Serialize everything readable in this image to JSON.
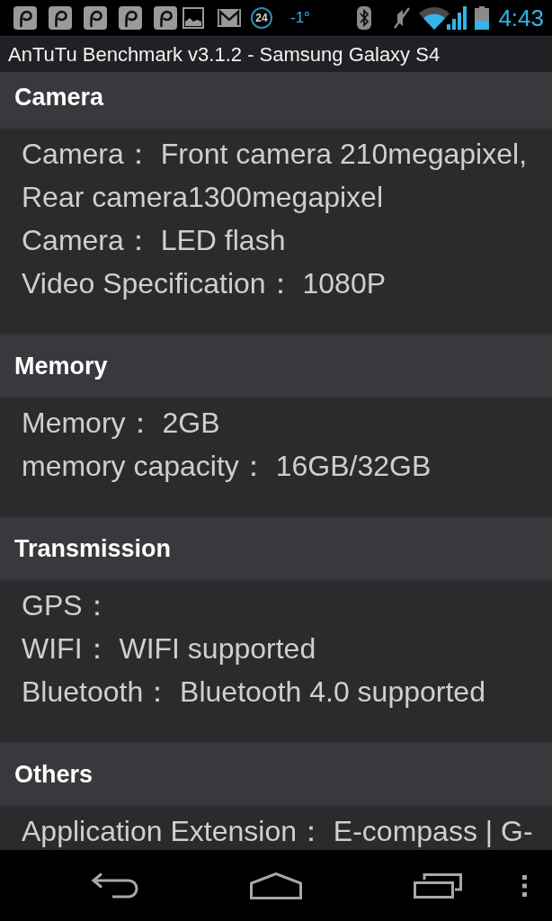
{
  "status_bar": {
    "counter": "24",
    "temperature": "-1°",
    "time": "4:43"
  },
  "title_bar": {
    "title": "AnTuTu Benchmark v3.1.2 - Samsung Galaxy S4"
  },
  "sections": [
    {
      "title": "Camera",
      "items": [
        "Camera： Front camera 210megapixel, Rear camera1300megapixel",
        "Camera： LED flash",
        "Video Specification： 1080P"
      ]
    },
    {
      "title": "Memory",
      "items": [
        "Memory： 2GB",
        "memory capacity： 16GB/32GB"
      ]
    },
    {
      "title": "Transmission",
      "items": [
        "GPS：",
        "WIFI： WIFI supported",
        "Bluetooth： Bluetooth 4.0 supported"
      ]
    },
    {
      "title": "Others",
      "items": [
        "Application Extension： E-compass | G-"
      ]
    }
  ]
}
